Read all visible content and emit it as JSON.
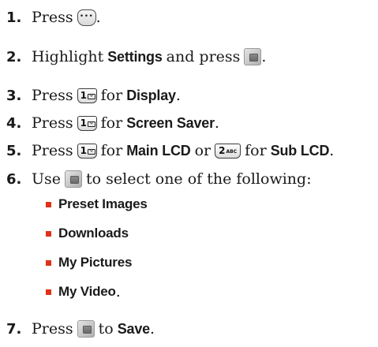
{
  "steps": [
    {
      "num": "1.",
      "pre": "Press",
      "post": "."
    },
    {
      "num": "2.",
      "pre": "Highlight",
      "bold1": "Settings",
      "mid": "and press",
      "post": "."
    },
    {
      "num": "3.",
      "pre": "Press",
      "key_digit": "1",
      "mid": "for",
      "bold1": "Display",
      "post": "."
    },
    {
      "num": "4.",
      "pre": "Press",
      "key_digit": "1",
      "mid": "for",
      "bold1": "Screen Saver",
      "post": "."
    },
    {
      "num": "5.",
      "pre": "Press",
      "key_digit": "1",
      "mid": "for",
      "bold1": "Main LCD",
      "or": "or",
      "key2_digit": "2",
      "key2_sub": "ABC",
      "mid2": "for",
      "bold2": "Sub LCD",
      "post": "."
    },
    {
      "num": "6.",
      "pre": "Use",
      "post": "to select one of the following:"
    },
    {
      "num": "7.",
      "pre": "Press",
      "mid": "to",
      "bold1": "Save",
      "post": "."
    }
  ],
  "bullets": [
    {
      "label": "Preset Images",
      "post": ""
    },
    {
      "label": "Downloads",
      "post": ""
    },
    {
      "label": "My Pictures",
      "post": ""
    },
    {
      "label": "My Video",
      "post": "."
    }
  ],
  "icons": {
    "menu_key": "menu-key-icon",
    "ok_key": "ok-key-icon",
    "number_key": "number-key-icon"
  },
  "colors": {
    "bullet": "#e0311a",
    "text": "#1a1a1a"
  }
}
